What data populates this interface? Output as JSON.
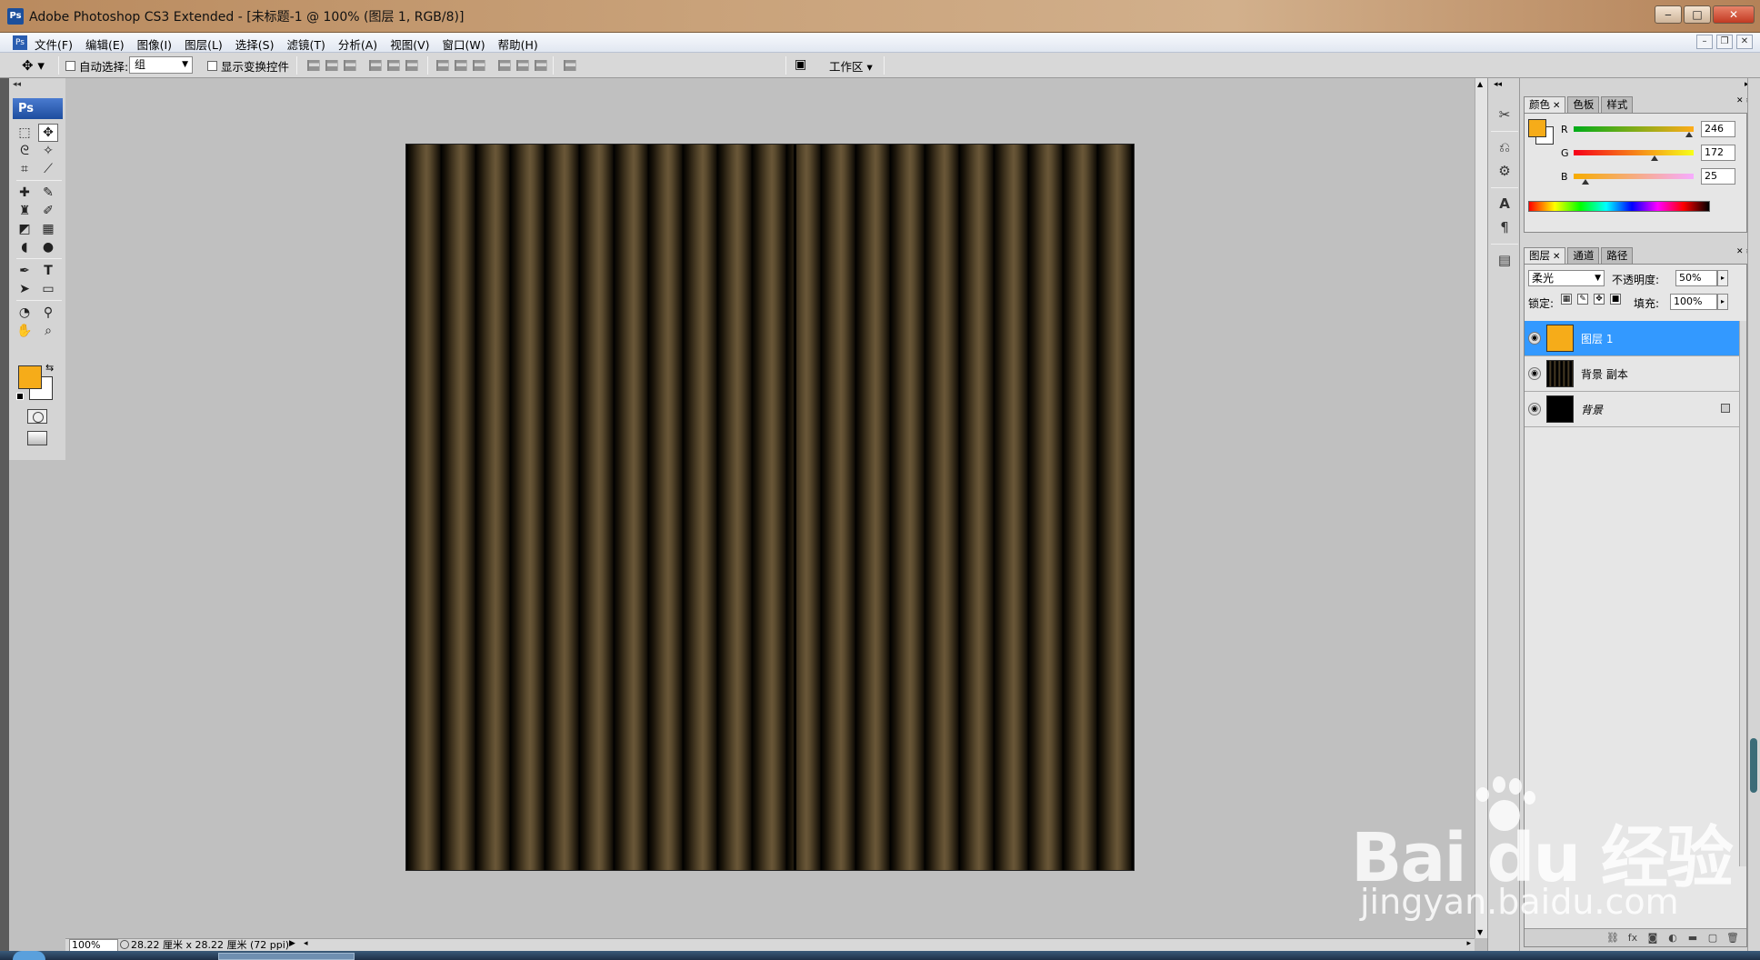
{
  "window": {
    "app_badge": "Ps",
    "title": "Adobe Photoshop CS3 Extended - [未标题-1 @ 100% (图层 1, RGB/8)]",
    "minimize": "‒",
    "maximize": "□",
    "close": "✕"
  },
  "menubar": {
    "doc_badge": "Ps",
    "items": [
      "文件(F)",
      "编辑(E)",
      "图像(I)",
      "图层(L)",
      "选择(S)",
      "滤镜(T)",
      "分析(A)",
      "视图(V)",
      "窗口(W)",
      "帮助(H)"
    ],
    "mdi_minimize": "–",
    "mdi_restore": "❐",
    "mdi_close": "✕"
  },
  "options": {
    "auto_select_label": "自动选择:",
    "auto_select_value": "组",
    "show_transform_label": "显示变换控件",
    "workspace_label": "工作区 ▾"
  },
  "tools": {
    "logo": "Ps",
    "foreground_color": "#f6ac19",
    "background_color": "#ffffff"
  },
  "statusbar": {
    "zoom": "100%",
    "doc_info": "28.22 厘米 x 28.22 厘米 (72 ppi)"
  },
  "color_panel": {
    "tabs": [
      "颜色",
      "色板",
      "样式"
    ],
    "channels": [
      {
        "label": "R",
        "value": "246",
        "fraction": 0.965
      },
      {
        "label": "G",
        "value": "172",
        "fraction": 0.675
      },
      {
        "label": "B",
        "value": "25",
        "fraction": 0.098
      }
    ]
  },
  "layers_panel": {
    "tabs": [
      "图层",
      "通道",
      "路径"
    ],
    "blend_mode": "柔光",
    "opacity_label": "不透明度:",
    "opacity_value": "50%",
    "lock_label": "锁定:",
    "fill_label": "填充:",
    "fill_value": "100%",
    "layers": [
      {
        "name": "图层 1",
        "selected": true,
        "thumb": "orange"
      },
      {
        "name": "背景 副本",
        "selected": false,
        "thumb": "stripes"
      },
      {
        "name": "背景",
        "selected": false,
        "thumb": "black",
        "locked": true
      }
    ]
  },
  "watermark": {
    "main": "Bai du 经验",
    "sub": "jingyan.baidu.com"
  }
}
